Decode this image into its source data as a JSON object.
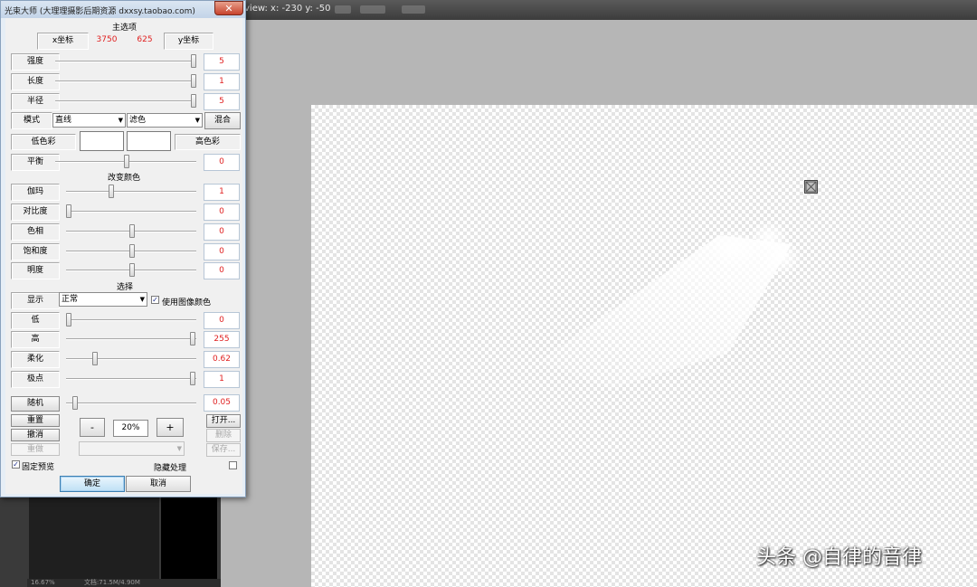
{
  "photoshop": {
    "info_text": "view:  x: -230 y: -50",
    "status_zoom": "16.67%",
    "status_doc": "文档:71.5M/4.90M",
    "watermark": "头条 @自律的音律"
  },
  "dialog": {
    "title": "光束大师 (大理理摄影后期资源 dxxsy.taobao.com)",
    "close_label": "✕",
    "main_section": "主选项",
    "x_coord_label": "x坐标",
    "x_value": "3750",
    "y_value": "625",
    "y_coord_label": "y坐标",
    "strength": {
      "label": "强度",
      "value": "5"
    },
    "length": {
      "label": "长度",
      "value": "1"
    },
    "radius": {
      "label": "半径",
      "value": "5"
    },
    "mode_label": "模式",
    "mode_select": "直线",
    "blend_select": "滤色",
    "blend_button": "混合",
    "low_color_label": "低色彩",
    "high_color_label": "高色彩",
    "balance": {
      "label": "平衡",
      "value": "0"
    },
    "change_color_section": "改变颜色",
    "gamma": {
      "label": "伽玛",
      "value": "1"
    },
    "contrast": {
      "label": "对比度",
      "value": "0"
    },
    "hue": {
      "label": "色相",
      "value": "0"
    },
    "saturation": {
      "label": "饱和度",
      "value": "0"
    },
    "brightness": {
      "label": "明度",
      "value": "0"
    },
    "select_section": "选择",
    "display_label": "显示",
    "display_select": "正常",
    "use_image_color_label": "使用图像颜色",
    "use_image_color_checked": true,
    "low": {
      "label": "低",
      "value": "0"
    },
    "high": {
      "label": "高",
      "value": "255"
    },
    "soften": {
      "label": "柔化",
      "value": "0.62"
    },
    "pole": {
      "label": "极点",
      "value": "1"
    },
    "random": {
      "label": "随机",
      "value": "0.05"
    },
    "reset_label": "重置",
    "undo_label": "撤消",
    "redo_label": "重做",
    "zoom_minus": "-",
    "zoom_value": "20%",
    "zoom_plus": "+",
    "open_label": "打开...",
    "delete_label": "删除",
    "save_label": "保存...",
    "fixed_preview_label": "固定预览",
    "fixed_preview_checked": true,
    "hide_processing_label": "隐藏处理",
    "hide_processing_checked": false,
    "ok_label": "确定",
    "cancel_label": "取消",
    "slider_levels": {
      "strength": 1.0,
      "length": 1.0,
      "radius": 1.0,
      "balance": 0.5,
      "gamma": 0.35,
      "contrast": 0.0,
      "hue": 0.5,
      "saturation": 0.5,
      "brightness": 0.5,
      "low": 0.0,
      "high": 1.0,
      "soften": 0.22,
      "pole": 1.0,
      "random": 0.04
    }
  }
}
